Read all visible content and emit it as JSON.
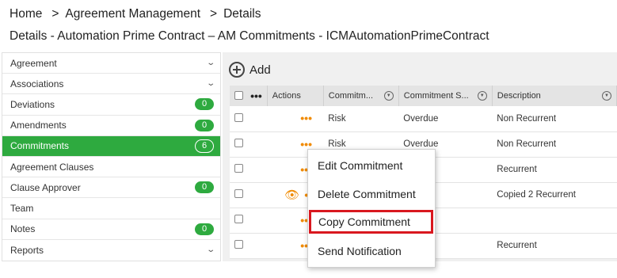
{
  "breadcrumb": {
    "home": "Home",
    "sep": ">",
    "level1": "Agreement Management",
    "level2": "Details"
  },
  "page_title": "Details - Automation Prime Contract – AM Commitments - ICMAutomationPrimeContract",
  "sidebar": {
    "items": [
      {
        "label": "Agreement",
        "chevron": "⌄"
      },
      {
        "label": "Associations",
        "chevron": "⌄"
      },
      {
        "label": "Deviations",
        "badge": "0"
      },
      {
        "label": "Amendments",
        "badge": "0"
      },
      {
        "label": "Commitments",
        "badge": "6"
      },
      {
        "label": "Agreement Clauses"
      },
      {
        "label": "Clause Approver",
        "badge": "0"
      },
      {
        "label": "Team"
      },
      {
        "label": "Notes",
        "badge": "0"
      },
      {
        "label": "Reports",
        "chevron": "⌄"
      }
    ]
  },
  "toolbar": {
    "add_label": "Add"
  },
  "table": {
    "header_dots": "•••",
    "columns": [
      "Actions",
      "Commitm...",
      "Commitment S...",
      "Description"
    ],
    "rows": [
      {
        "commitment": "Risk",
        "status": "Overdue",
        "description": "Non Recurrent"
      },
      {
        "commitment": "Risk",
        "status": "Overdue",
        "description": "Non Recurrent"
      },
      {
        "commitment": "",
        "status": "e",
        "description": "Recurrent"
      },
      {
        "commitment": "",
        "status": "ed",
        "description": "Copied 2 Recurrent"
      },
      {
        "commitment": "",
        "status": "e",
        "description": ""
      },
      {
        "commitment": "",
        "status": "e",
        "description": "Recurrent"
      }
    ],
    "action_dots": "•••"
  },
  "context_menu": {
    "items": [
      "Edit Commitment",
      "Delete Commitment",
      "Copy Commitment",
      "Send Notification"
    ]
  },
  "colors": {
    "accent_green": "#2eaa3f",
    "action_orange": "#f08a00",
    "highlight_red": "#d9181f"
  }
}
